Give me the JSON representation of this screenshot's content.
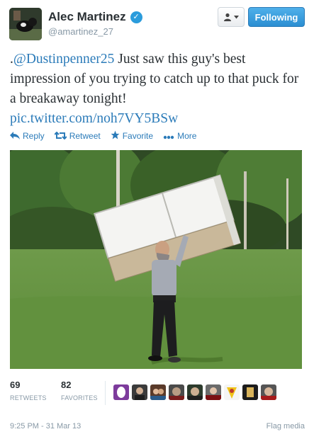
{
  "user": {
    "display_name": "Alec Martinez",
    "handle": "@amartinez_27",
    "verified_mark": "✓"
  },
  "header": {
    "user_dropdown_icon": "person-icon",
    "follow_label": "Following"
  },
  "tweet": {
    "prefix": ".",
    "mention": "@Dustinpenner25",
    "body": " Just saw this guy's best impression of you trying to catch up to that puck for a breakaway tonight!",
    "pic_link": "pic.twitter.com/noh7VY5BSw"
  },
  "actions": {
    "reply": "Reply",
    "retweet": "Retweet",
    "favorite": "Favorite",
    "more": "More"
  },
  "stats": {
    "retweets_count": "69",
    "retweets_label": "RETWEETS",
    "favorites_count": "82",
    "favorites_label": "FAVORITES"
  },
  "footer": {
    "timestamp": "9:25 PM - 31 Mar 13",
    "flag": "Flag media"
  },
  "colors": {
    "link": "#2b7bb9",
    "follow_button": "#2b8ed2",
    "muted": "#8899a6"
  }
}
